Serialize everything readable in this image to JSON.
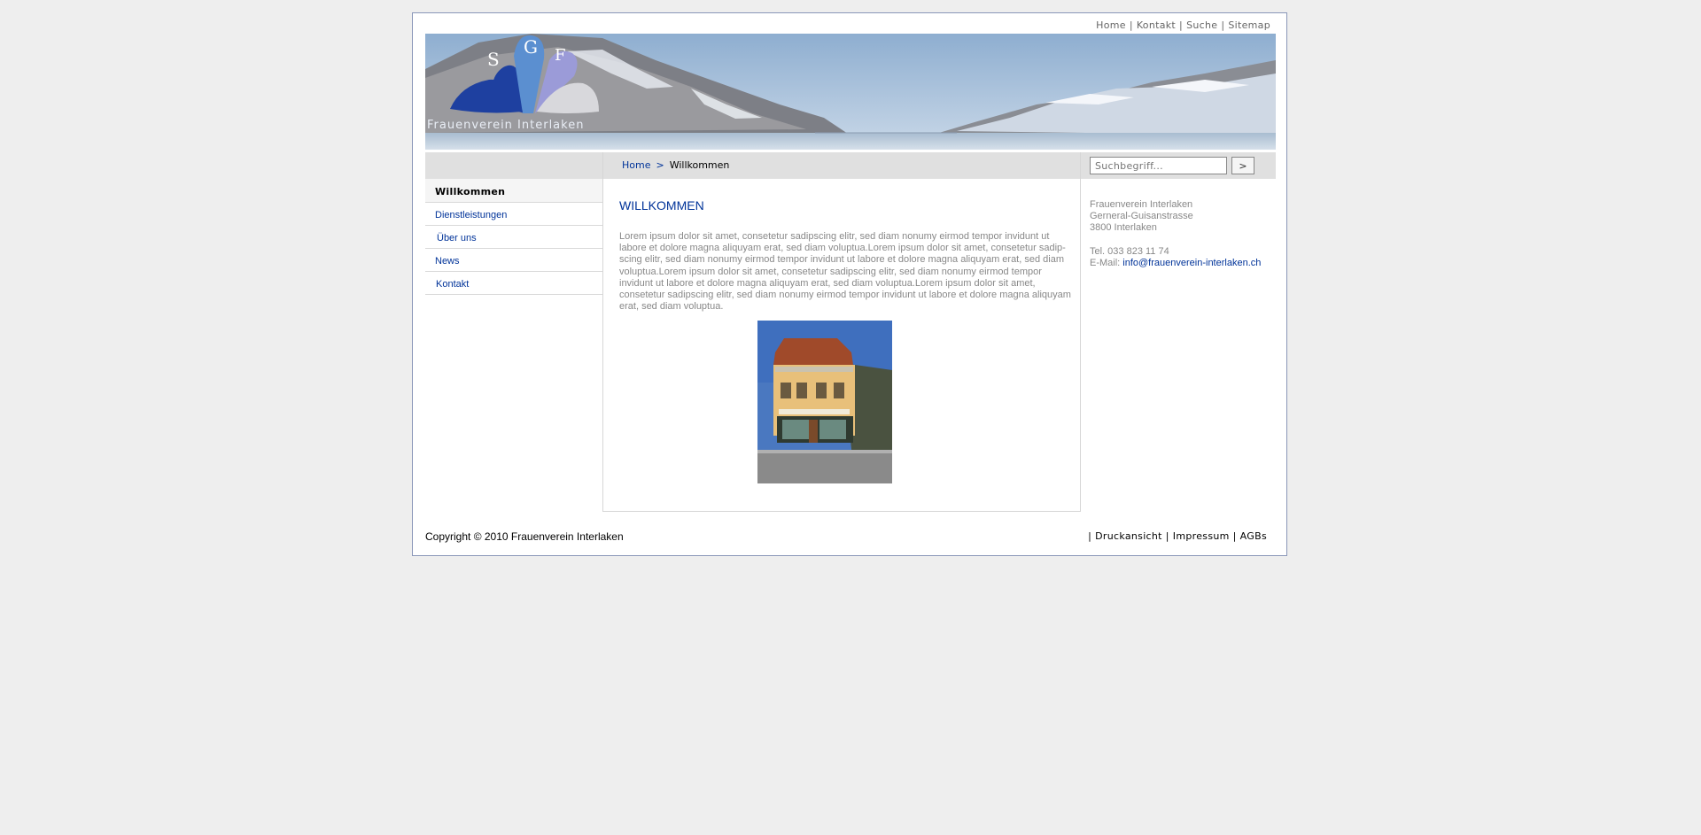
{
  "topnav": {
    "home": "Home",
    "kontakt": "Kontakt",
    "suche": "Suche",
    "sitemap": "Sitemap",
    "separator": "|"
  },
  "banner": {
    "logo_letters": [
      "S",
      "G",
      "F"
    ],
    "logo_caption": "Frauenverein Interlaken",
    "colors": {
      "petal_dark": "#1e40a0",
      "petal_mid": "#5b8fd0",
      "petal_light": "#9b9bd8",
      "petal_grey": "#d8d8dc"
    }
  },
  "sidebar": {
    "items": [
      {
        "label": "Willkommen",
        "active": true
      },
      {
        "label": "Dienstleistungen",
        "active": false
      },
      {
        "label": "Über uns",
        "active": false
      },
      {
        "label": "News",
        "active": false
      },
      {
        "label": "Kontakt",
        "active": false
      }
    ]
  },
  "breadcrumb": {
    "home": "Home",
    "arrow": ">",
    "current": "Willkommen"
  },
  "main": {
    "title": "WILLKOMMEN",
    "body": "Lorem ipsum dolor sit amet, consetetur sadipscing elitr, sed diam nonumy eirmod tempor invidunt ut labore et dolore magna aliquyam erat, sed diam voluptua.Lorem ipsum dolor sit amet, consetetur sadip-scing elitr, sed diam nonumy eirmod tempor invidunt ut labore et dolore magna aliquyam erat, sed diam voluptua.Lorem ipsum dolor sit amet, consetetur sadipscing elitr, sed diam nonumy eirmod tempor invidunt ut labore et dolore magna aliquyam erat, sed diam voluptua.Lorem ipsum dolor sit amet, consetetur sadipscing elitr, sed diam nonumy eirmod tempor invidunt ut labore et dolore magna aliquyam erat, sed diam voluptua."
  },
  "search": {
    "placeholder": "Suchbegriff...",
    "button": ">"
  },
  "address": {
    "name": "Frauenverein Interlaken",
    "street": "Gerneral-Guisanstrasse",
    "city": "3800 Interlaken",
    "tel": "Tel. 033 823 11 74",
    "email_label": "E-Mail: ",
    "email": "info@frauenverein-interlaken.ch"
  },
  "footer": {
    "copyright": "Copyright © 2010 Frauenverein Interlaken",
    "links": {
      "print": "Druckansicht",
      "imprint": "Impressum",
      "terms": "AGBs"
    },
    "separator": "|"
  },
  "colors": {
    "link": "#003399",
    "bar_grey": "#e0e0e0",
    "page_bg": "#eeeeee",
    "text_grey": "#888888"
  }
}
